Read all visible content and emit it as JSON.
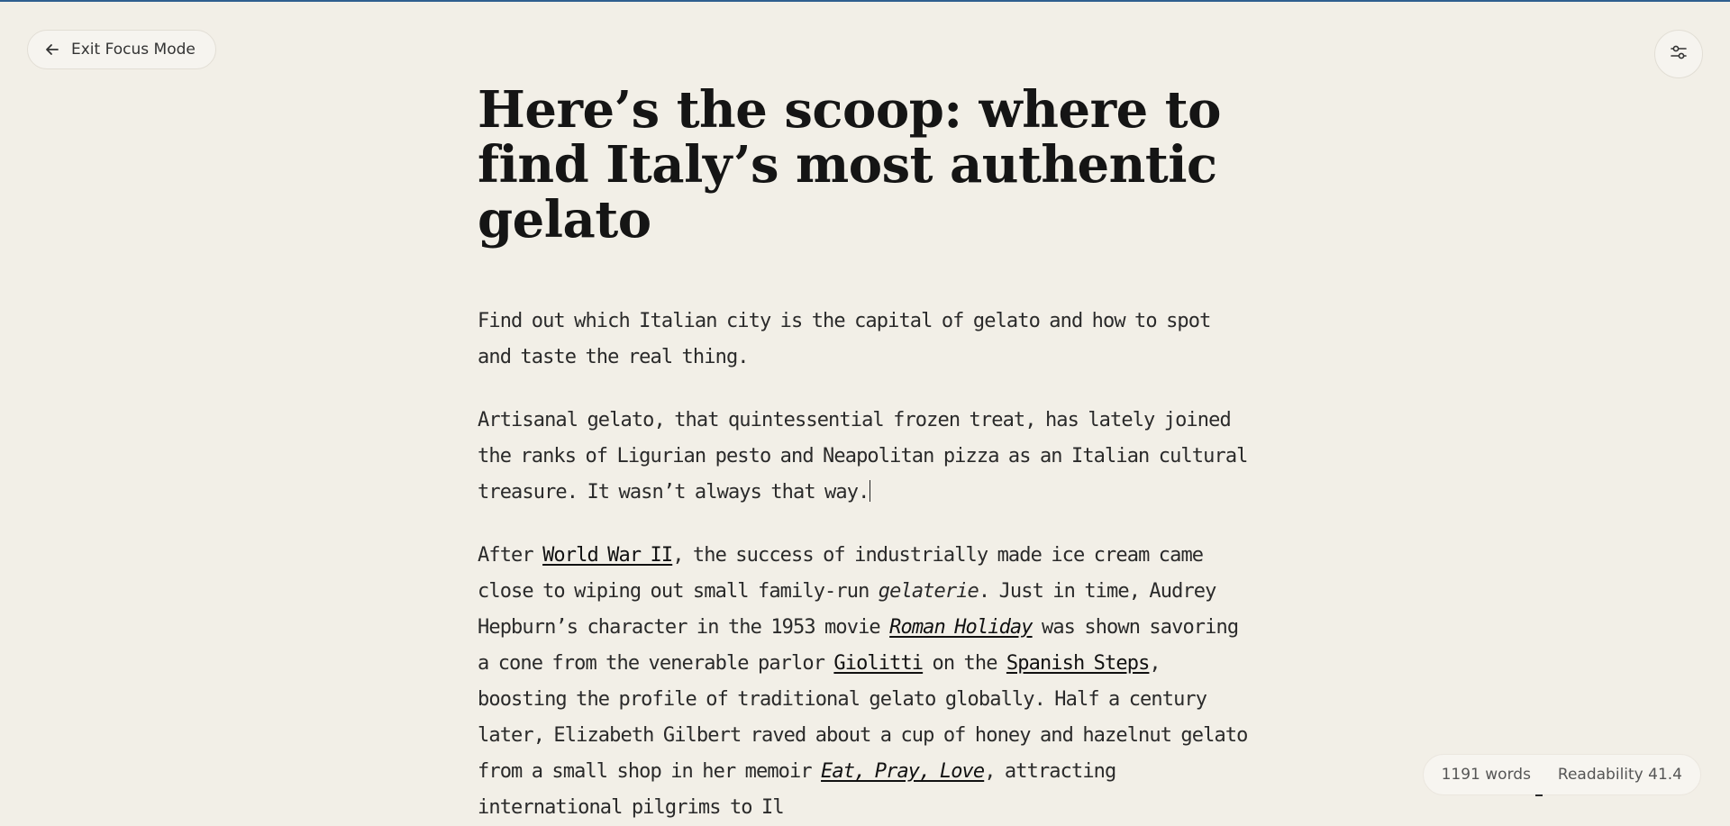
{
  "toolbar": {
    "exit_label": "Exit Focus Mode"
  },
  "article": {
    "title": "Here’s the scoop: where to find Italy’s most authentic gelato",
    "subtitle": "Find out which Italian city is the capital of gelato and how to spot and taste the real thing.",
    "intro": "Artisanal gelato, that quintessential frozen treat, has lately joined the ranks of Ligurian pesto and Neapolitan pizza as an Italian cultural treasure. It wasn’t always that way.",
    "body": {
      "t1": "After ",
      "link1": "World War II",
      "t2": ", the success of industrially made ice cream came close to wiping out small family-run ",
      "em1": "gelaterie",
      "t3": ". Just in time, Audrey Hepburn’s character in the 1953 movie ",
      "link2": "Roman Holiday",
      "t4": " was shown savoring a cone from the venerable parlor ",
      "link3": "Giolitti",
      "t5": " on the ",
      "link4": "Spanish Steps",
      "t6": ", boosting the profile of traditional gelato globally. Half a century later, Elizabeth Gilbert raved about a cup of honey and hazelnut gelato from a small shop in her memoir ",
      "link5": "Eat, Pray, Love",
      "t7": ", attracting international pilgrims to Il"
    }
  },
  "status": {
    "words": "1191 words",
    "readability": "Readability 41.4"
  },
  "icons": {
    "exit": "arrow-left-icon",
    "settings": "sliders-icon"
  },
  "colors": {
    "background": "#f2efe7",
    "text": "#1c1c1c",
    "top_border": "#2f5f8f"
  }
}
